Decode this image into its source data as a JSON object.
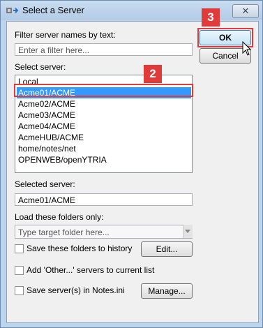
{
  "window": {
    "title": "Select a Server",
    "close_symbol": "✕"
  },
  "filter": {
    "label": "Filter server names by text:",
    "placeholder": "Enter a filter here..."
  },
  "server_list": {
    "label": "Select server:",
    "items": [
      "Local",
      "Acme01/ACME",
      "Acme02/ACME",
      "Acme03/ACME",
      "Acme04/ACME",
      "AcmeHUB/ACME",
      "home/notes/net",
      "OPENWEB/openYTRIA"
    ],
    "selected_index": 1
  },
  "buttons": {
    "ok": "OK",
    "cancel": "Cancel",
    "edit": "Edit...",
    "manage": "Manage..."
  },
  "selected_server": {
    "label": "Selected server:",
    "value": "Acme01/ACME"
  },
  "folders": {
    "label": "Load these folders only:",
    "placeholder": "Type target folder here..."
  },
  "checkboxes": {
    "save_history": "Save these folders to history",
    "add_other": "Add 'Other...' servers to current list",
    "save_ini": "Save server(s) in Notes.ini"
  },
  "callouts": {
    "ok_step": "3",
    "select_step": "2"
  },
  "colors": {
    "highlight": "#3399ff",
    "callout": "#e03a3a"
  }
}
